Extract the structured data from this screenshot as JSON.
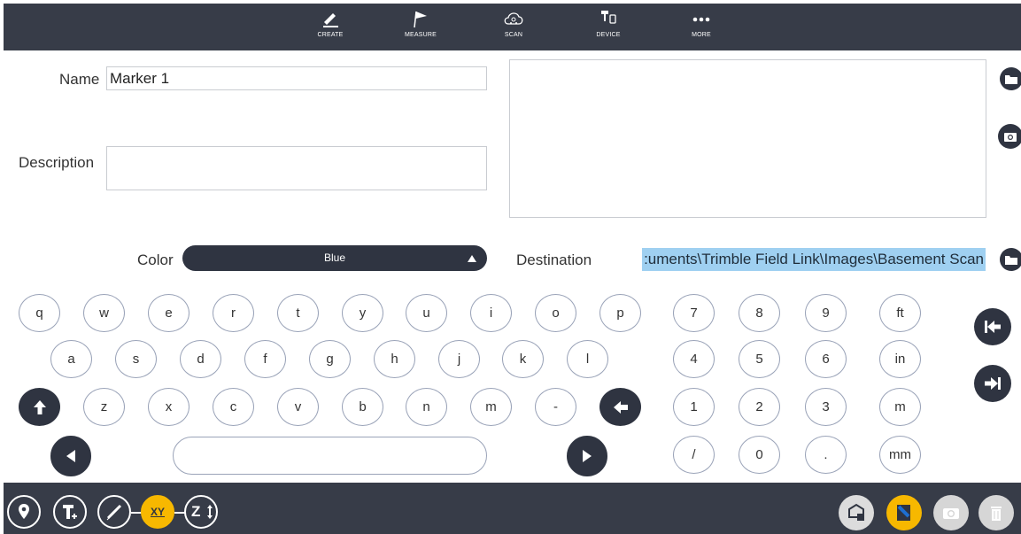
{
  "toolbar": {
    "items": [
      {
        "label": "CREATE",
        "icon": "pencil-icon"
      },
      {
        "label": "MEASURE",
        "icon": "flag-icon"
      },
      {
        "label": "SCAN",
        "icon": "cloud-scan-icon"
      },
      {
        "label": "DEVICE",
        "icon": "device-icon"
      },
      {
        "label": "MORE",
        "icon": "more-dots-icon"
      }
    ]
  },
  "form": {
    "name_label": "Name",
    "name_value": "Marker 1",
    "description_label": "Description",
    "description_value": "",
    "color_label": "Color",
    "color_value": "Blue",
    "destination_label": "Destination",
    "destination_value": ":uments\\Trimble Field Link\\Images\\Basement Scan"
  },
  "keyboard": {
    "row1": [
      "q",
      "w",
      "e",
      "r",
      "t",
      "y",
      "u",
      "i",
      "o",
      "p"
    ],
    "row2": [
      "a",
      "s",
      "d",
      "f",
      "g",
      "h",
      "j",
      "k",
      "l"
    ],
    "row3": [
      "z",
      "x",
      "c",
      "v",
      "b",
      "n",
      "m",
      "-"
    ],
    "numpad": [
      "7",
      "8",
      "9",
      "ft",
      "4",
      "5",
      "6",
      "in",
      "1",
      "2",
      "3",
      "m",
      "/",
      "0",
      ".",
      "mm"
    ]
  },
  "bottom": {
    "xy_label": "XY",
    "z_label": "Z"
  },
  "colors": {
    "bar": "#373c48",
    "dark_button": "#2f3441",
    "accent": "#f7b800",
    "selection": "#9fd0f1"
  }
}
